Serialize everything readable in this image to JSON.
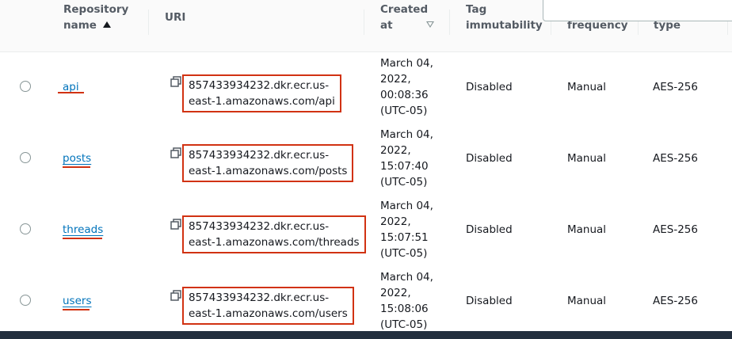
{
  "header": {
    "repo_name_line1": "Repository",
    "repo_name_line2": "name",
    "uri": "URI",
    "created_line1": "Created",
    "created_line2": "at",
    "tag_line1": "Tag",
    "tag_line2": "immutability",
    "freq_line2": "frequency",
    "type_line2": "type"
  },
  "rows": [
    {
      "name": "api",
      "uri_line1": "857433934232.dkr.ecr.us-",
      "uri_line2": "east-1.amazonaws.com/api",
      "created_line1": "March 04,",
      "created_line2": "2022,",
      "created_line3": "00:08:36",
      "created_line4": "(UTC-05)",
      "tag_immutability": "Disabled",
      "scan_frequency": "Manual",
      "encryption_type": "AES-256"
    },
    {
      "name": "posts",
      "uri_line1": "857433934232.dkr.ecr.us-",
      "uri_line2": "east-1.amazonaws.com/posts",
      "created_line1": "March 04,",
      "created_line2": "2022,",
      "created_line3": "15:07:40",
      "created_line4": "(UTC-05)",
      "tag_immutability": "Disabled",
      "scan_frequency": "Manual",
      "encryption_type": "AES-256"
    },
    {
      "name": "threads",
      "uri_line1": "857433934232.dkr.ecr.us-",
      "uri_line2": "east-1.amazonaws.com/threads",
      "created_line1": "March 04,",
      "created_line2": "2022,",
      "created_line3": "15:07:51",
      "created_line4": "(UTC-05)",
      "tag_immutability": "Disabled",
      "scan_frequency": "Manual",
      "encryption_type": "AES-256"
    },
    {
      "name": "users",
      "uri_line1": "857433934232.dkr.ecr.us-",
      "uri_line2": "east-1.amazonaws.com/users",
      "created_line1": "March 04,",
      "created_line2": "2022,",
      "created_line3": "15:08:06",
      "created_line4": "(UTC-05)",
      "tag_immutability": "Disabled",
      "scan_frequency": "Manual",
      "encryption_type": "AES-256"
    }
  ],
  "colors": {
    "link": "#0073bb",
    "annotation_red": "#d13212",
    "footer": "#232f3e"
  }
}
